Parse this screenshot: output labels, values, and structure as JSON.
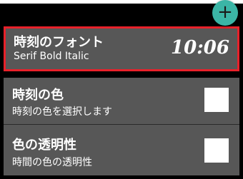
{
  "fab": {
    "icon": "plus-icon",
    "glyph": "+",
    "color": "#3bb5a6"
  },
  "font_setting": {
    "title": "時刻のフォント",
    "subtitle": "Serif Bold Italic",
    "preview_time": "10:06",
    "highlight_color": "#e8212a"
  },
  "time_color_setting": {
    "title": "時刻の色",
    "subtitle": "時刻の色を選択します",
    "checked": false
  },
  "opacity_setting": {
    "title": "色の透明性",
    "subtitle": "時間の色の透明性",
    "checked": false
  }
}
